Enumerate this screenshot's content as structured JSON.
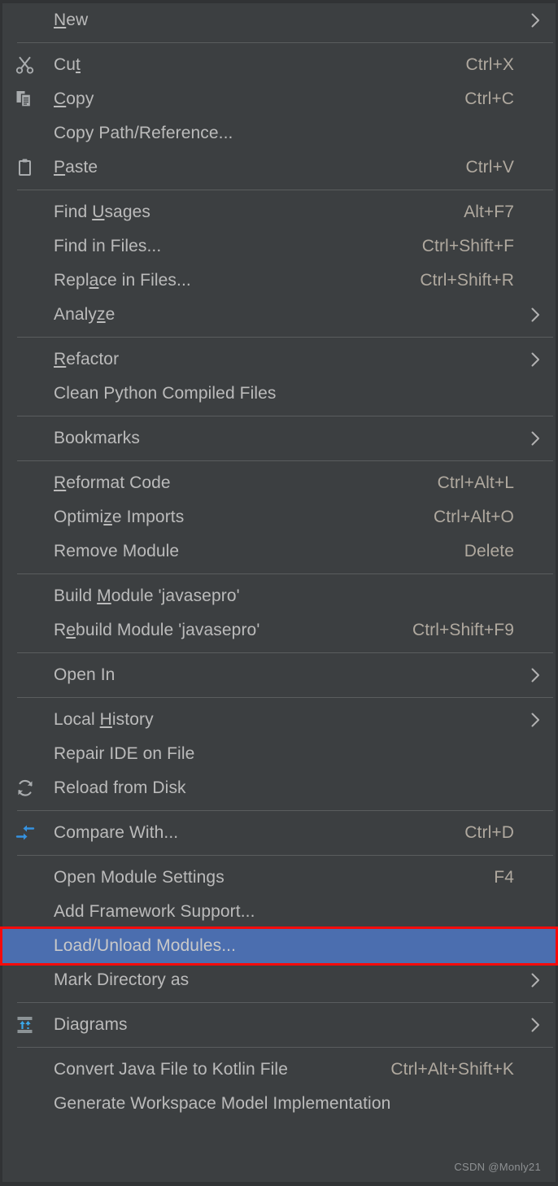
{
  "menu": {
    "title": "Project context menu",
    "background_color": "#3c3f41",
    "text_color": "#bbbbbb",
    "shortcut_color": "#b0a99f",
    "separator_color": "#5a5d5e",
    "selected_background": "#4b6eaf",
    "selected_outline": "#f40b0b",
    "accent_icon_color": "#4a9ede",
    "groups": [
      {
        "items": [
          {
            "label": "New",
            "mnemonic": "N",
            "shortcut": "",
            "icon": "",
            "submenu": true,
            "selected": false
          }
        ]
      },
      {
        "items": [
          {
            "label": "Cut",
            "mnemonic": "t",
            "shortcut": "Ctrl+X",
            "icon": "scissors-icon",
            "submenu": false,
            "selected": false
          },
          {
            "label": "Copy",
            "mnemonic": "C",
            "shortcut": "Ctrl+C",
            "icon": "copy-icon",
            "submenu": false,
            "selected": false
          },
          {
            "label": "Copy Path/Reference...",
            "mnemonic": "",
            "shortcut": "",
            "icon": "",
            "submenu": false,
            "selected": false
          },
          {
            "label": "Paste",
            "mnemonic": "P",
            "shortcut": "Ctrl+V",
            "icon": "clipboard-icon",
            "submenu": false,
            "selected": false
          }
        ]
      },
      {
        "items": [
          {
            "label": "Find Usages",
            "mnemonic": "U",
            "shortcut": "Alt+F7",
            "icon": "",
            "submenu": false,
            "selected": false
          },
          {
            "label": "Find in Files...",
            "mnemonic": "",
            "shortcut": "Ctrl+Shift+F",
            "icon": "",
            "submenu": false,
            "selected": false
          },
          {
            "label": "Replace in Files...",
            "mnemonic": "a",
            "shortcut": "Ctrl+Shift+R",
            "icon": "",
            "submenu": false,
            "selected": false
          },
          {
            "label": "Analyze",
            "mnemonic": "z",
            "shortcut": "",
            "icon": "",
            "submenu": true,
            "selected": false
          }
        ]
      },
      {
        "items": [
          {
            "label": "Refactor",
            "mnemonic": "R",
            "shortcut": "",
            "icon": "",
            "submenu": true,
            "selected": false
          },
          {
            "label": "Clean Python Compiled Files",
            "mnemonic": "",
            "shortcut": "",
            "icon": "",
            "submenu": false,
            "selected": false
          }
        ]
      },
      {
        "items": [
          {
            "label": "Bookmarks",
            "mnemonic": "",
            "shortcut": "",
            "icon": "",
            "submenu": true,
            "selected": false
          }
        ]
      },
      {
        "items": [
          {
            "label": "Reformat Code",
            "mnemonic": "R",
            "shortcut": "Ctrl+Alt+L",
            "icon": "",
            "submenu": false,
            "selected": false
          },
          {
            "label": "Optimize Imports",
            "mnemonic": "z",
            "shortcut": "Ctrl+Alt+O",
            "icon": "",
            "submenu": false,
            "selected": false
          },
          {
            "label": "Remove Module",
            "mnemonic": "",
            "shortcut": "Delete",
            "icon": "",
            "submenu": false,
            "selected": false
          }
        ]
      },
      {
        "items": [
          {
            "label": "Build Module 'javasepro'",
            "mnemonic": "M",
            "shortcut": "",
            "icon": "",
            "submenu": false,
            "selected": false
          },
          {
            "label": "Rebuild Module 'javasepro'",
            "mnemonic": "e",
            "shortcut": "Ctrl+Shift+F9",
            "icon": "",
            "submenu": false,
            "selected": false
          }
        ]
      },
      {
        "items": [
          {
            "label": "Open In",
            "mnemonic": "",
            "shortcut": "",
            "icon": "",
            "submenu": true,
            "selected": false
          }
        ]
      },
      {
        "items": [
          {
            "label": "Local History",
            "mnemonic": "H",
            "shortcut": "",
            "icon": "",
            "submenu": true,
            "selected": false
          },
          {
            "label": "Repair IDE on File",
            "mnemonic": "",
            "shortcut": "",
            "icon": "",
            "submenu": false,
            "selected": false
          },
          {
            "label": "Reload from Disk",
            "mnemonic": "",
            "shortcut": "",
            "icon": "reload-icon",
            "submenu": false,
            "selected": false
          }
        ]
      },
      {
        "items": [
          {
            "label": "Compare With...",
            "mnemonic": "",
            "shortcut": "Ctrl+D",
            "icon": "compare-icon",
            "submenu": false,
            "selected": false
          }
        ]
      },
      {
        "items": [
          {
            "label": "Open Module Settings",
            "mnemonic": "",
            "shortcut": "F4",
            "icon": "",
            "submenu": false,
            "selected": false
          },
          {
            "label": "Add Framework Support...",
            "mnemonic": "",
            "shortcut": "",
            "icon": "",
            "submenu": false,
            "selected": false
          },
          {
            "label": "Load/Unload Modules...",
            "mnemonic": "",
            "shortcut": "",
            "icon": "",
            "submenu": false,
            "selected": true
          },
          {
            "label": "Mark Directory as",
            "mnemonic": "",
            "shortcut": "",
            "icon": "",
            "submenu": true,
            "selected": false
          }
        ]
      },
      {
        "items": [
          {
            "label": "Diagrams",
            "mnemonic": "",
            "shortcut": "",
            "icon": "diagrams-icon",
            "submenu": true,
            "selected": false
          }
        ]
      },
      {
        "items": [
          {
            "label": "Convert Java File to Kotlin File",
            "mnemonic": "",
            "shortcut": "Ctrl+Alt+Shift+K",
            "icon": "",
            "submenu": false,
            "selected": false
          },
          {
            "label": "Generate Workspace Model Implementation",
            "mnemonic": "",
            "shortcut": "",
            "icon": "",
            "submenu": false,
            "selected": false
          }
        ]
      }
    ]
  },
  "watermark": {
    "text": "CSDN @Monly21"
  }
}
